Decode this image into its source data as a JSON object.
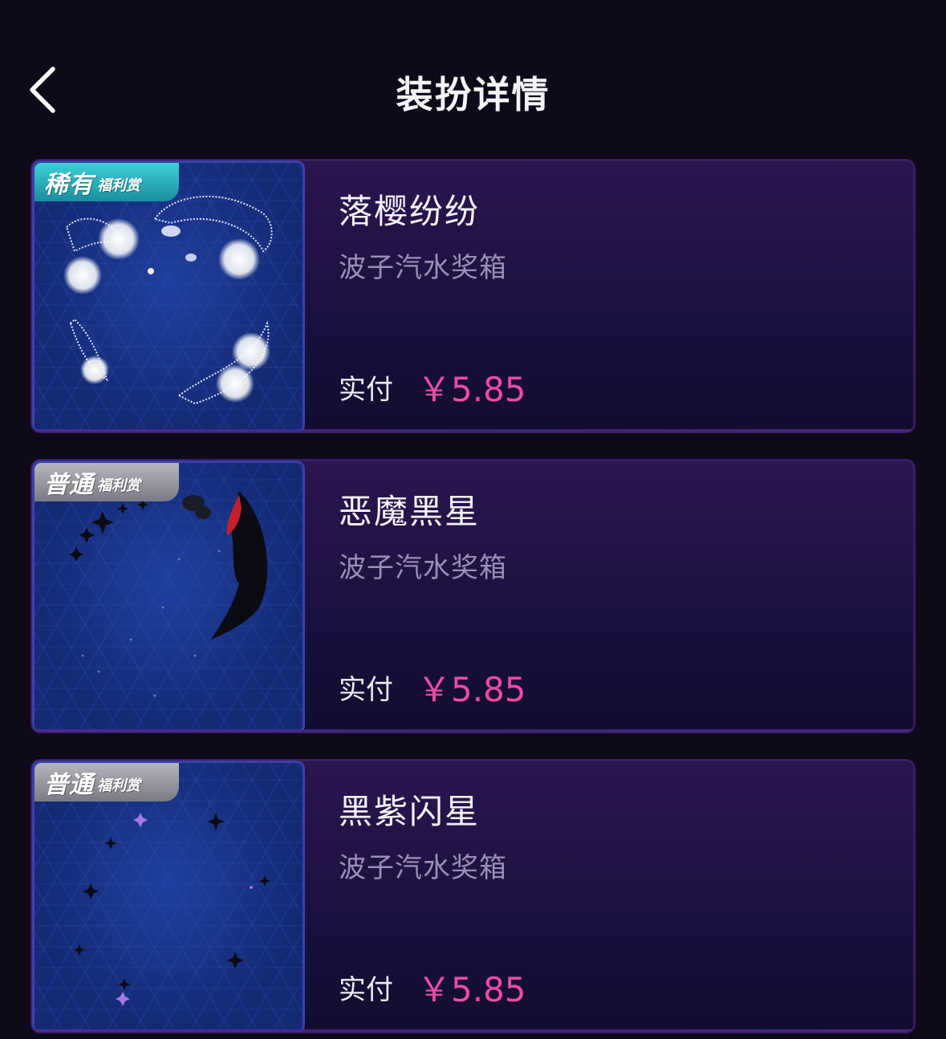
{
  "header": {
    "title": "装扮详情",
    "back_icon": "chevron-left-icon"
  },
  "items": [
    {
      "badge_main": "稀有",
      "badge_sub": "福利赏",
      "badge_color": "#2bb3c0",
      "name": "落樱纷纷",
      "source": "波子汽水奖箱",
      "pay_label": "实付",
      "price": "￥5.85"
    },
    {
      "badge_main": "普通",
      "badge_sub": "福利赏",
      "badge_color": "#9a9aa3",
      "name": "恶魔黑星",
      "source": "波子汽水奖箱",
      "pay_label": "实付",
      "price": "￥5.85"
    },
    {
      "badge_main": "普通",
      "badge_sub": "福利赏",
      "badge_color": "#9a9aa3",
      "name": "黑紫闪星",
      "source": "波子汽水奖箱",
      "pay_label": "实付",
      "price": "￥5.85"
    }
  ],
  "colors": {
    "background": "#0d0a1a",
    "price": "#f04aa8",
    "card_border": "#3a1f66"
  }
}
